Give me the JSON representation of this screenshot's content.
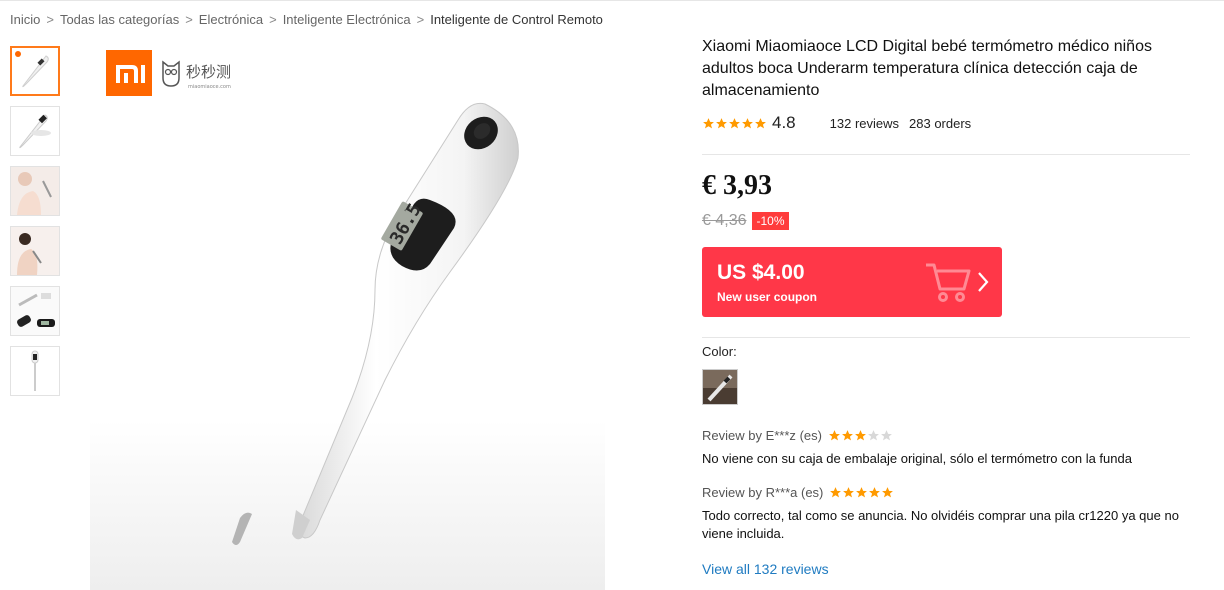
{
  "breadcrumb": {
    "items": [
      "Inicio",
      "Todas las categorías",
      "Electrónica",
      "Inteligente Electrónica",
      "Inteligente de Control Remoto"
    ],
    "separator": ">"
  },
  "gallery": {
    "brand_logo": "MI",
    "brand_name": "秒秒测",
    "brand_site": "miaomiaoce.com",
    "display_reading": "36.5",
    "display_unit": "°c",
    "accent_color": "#ff7a1a"
  },
  "product": {
    "title": "Xiaomi Miaomiaoce LCD Digital bebé termómetro médico niños adultos boca Underarm temperatura clínica detección caja de almacenamiento",
    "rating": 4.8,
    "rating_text": "4.8",
    "reviews_count_text": "132 reviews",
    "orders_count_text": "283 orders",
    "price": "€ 3,93",
    "old_price": "€ 4,36",
    "discount": "-10%"
  },
  "coupon": {
    "amount": "US $4.00",
    "label": "New user coupon",
    "background_color": "#ff3748"
  },
  "color_option": {
    "label": "Color:"
  },
  "reviews": [
    {
      "author": "Review by E***z",
      "lang": "(es)",
      "stars": 3,
      "text": "No viene con su caja de embalaje original, sólo el termómetro con la funda"
    },
    {
      "author": "Review by R***a",
      "lang": "(es)",
      "stars": 5,
      "text": "Todo correcto, tal como se anuncia. No olvidéis comprar una pila cr1220 ya que no viene incluida."
    }
  ],
  "view_all_link": "View all 132 reviews",
  "icons": {
    "star_filled": "star-icon",
    "star_empty": "star-empty-icon",
    "cart": "shopping-cart-icon",
    "chevron": "chevron-right-icon"
  },
  "colors": {
    "star": "#ff9a00",
    "star_empty": "#d8d8d8",
    "link": "#1f7bc1"
  }
}
